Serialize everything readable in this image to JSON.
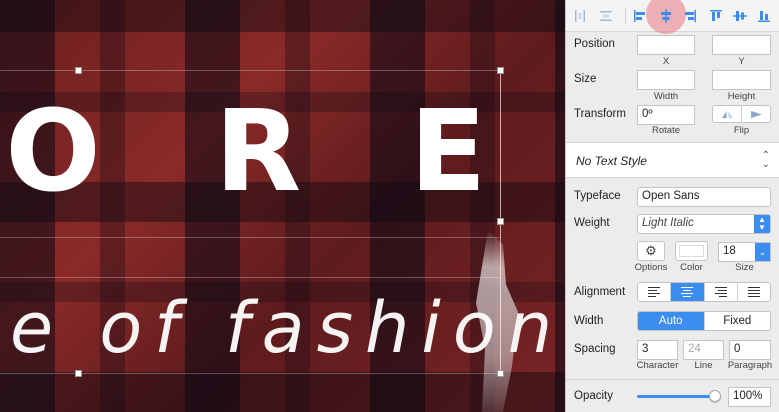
{
  "canvas": {
    "title_letters": [
      "O",
      "R",
      "E"
    ],
    "subtitle": "e of fashion"
  },
  "align_bar": {
    "buttons": [
      {
        "name": "distribute-horizontal-icon",
        "active": false
      },
      {
        "name": "distribute-vertical-icon",
        "active": false
      },
      {
        "name": "align-left-icon",
        "active": false
      },
      {
        "name": "align-horizontal-center-icon",
        "active": true
      },
      {
        "name": "align-right-icon",
        "active": false
      },
      {
        "name": "align-top-icon",
        "active": false
      },
      {
        "name": "align-vertical-center-icon",
        "active": false
      },
      {
        "name": "align-bottom-icon",
        "active": false
      }
    ]
  },
  "inspector": {
    "position": {
      "label": "Position",
      "x_label": "X",
      "y_label": "Y",
      "x_value": "",
      "y_value": ""
    },
    "size": {
      "label": "Size",
      "width_label": "Width",
      "height_label": "Height",
      "width_value": "",
      "height_value": ""
    },
    "transform": {
      "label": "Transform",
      "rotate_value": "0º",
      "rotate_label": "Rotate",
      "flip_label": "Flip"
    },
    "text_style": {
      "value": "No Text Style"
    },
    "typeface": {
      "label": "Typeface",
      "value": "Open Sans"
    },
    "weight": {
      "label": "Weight",
      "value": "Light Italic"
    },
    "options": {
      "options_label": "Options",
      "color_label": "Color",
      "size_label": "Size",
      "size_value": "18",
      "color_hex": "#ffffff"
    },
    "alignment": {
      "label": "Alignment",
      "selected": "center"
    },
    "width": {
      "label": "Width",
      "auto_label": "Auto",
      "fixed_label": "Fixed",
      "selected": "Auto"
    },
    "spacing": {
      "label": "Spacing",
      "character_value": "3",
      "line_value": "24",
      "paragraph_value": "0",
      "character_label": "Character",
      "line_label": "Line",
      "paragraph_label": "Paragraph"
    },
    "opacity": {
      "label": "Opacity",
      "value": "100%",
      "level": 1.0
    }
  },
  "colors": {
    "accent": "#3b8df0",
    "highlight": "#eb7882"
  }
}
